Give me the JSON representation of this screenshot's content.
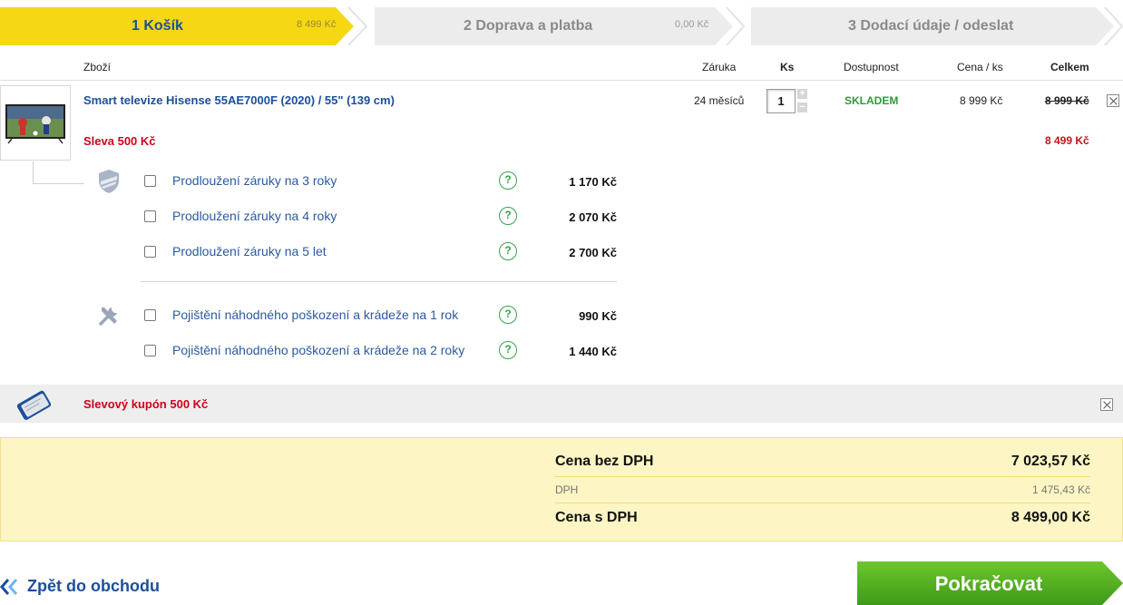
{
  "steps": [
    {
      "title": "1 Košík",
      "amount": "8 499 Kč",
      "active": true
    },
    {
      "title": "2 Doprava a platba",
      "amount": "0,00 Kč",
      "active": false
    },
    {
      "title": "3 Dodací údaje / odeslat",
      "amount": "",
      "active": false
    }
  ],
  "table_header": {
    "item": "Zboží",
    "warranty": "Záruka",
    "qty": "Ks",
    "availability": "Dostupnost",
    "unit_price": "Cena / ks",
    "total": "Celkem"
  },
  "product": {
    "name": "Smart televize Hisense 55AE7000F (2020) / 55\" (139 cm)",
    "warranty": "24 měsíců",
    "quantity": "1",
    "availability": "SKLADEM",
    "unit_price": "8 999 Kč",
    "old_total": "8 999 Kč",
    "discount_label": "Sleva 500 Kč",
    "new_total": "8 499 Kč",
    "image_icon": "tv-thumbnail"
  },
  "services": {
    "warranty_icon": "shield-icon",
    "insurance_icon": "tools-icon",
    "warranty_options": [
      {
        "label": "Prodloužení záruky na 3 roky",
        "price": "1 170 Kč"
      },
      {
        "label": "Prodloužení záruky na 4 roky",
        "price": "2 070 Kč"
      },
      {
        "label": "Prodloužení záruky na 5 let",
        "price": "2 700 Kč"
      }
    ],
    "insurance_options": [
      {
        "label": "Pojištění náhodného poškození a krádeže na 1 rok",
        "price": "990 Kč"
      },
      {
        "label": "Pojištění náhodného poškození a krádeže na 2 roky",
        "price": "1 440 Kč"
      }
    ],
    "help_glyph": "?"
  },
  "coupon": {
    "label": "Slevový kupón 500 Kč",
    "icon": "coupon-card-icon"
  },
  "summary": {
    "net_label": "Cena bez DPH",
    "net_value": "7 023,57 Kč",
    "vat_label": "DPH",
    "vat_value": "1 475,43 Kč",
    "gross_label": "Cena s DPH",
    "gross_value": "8 499,00 Kč"
  },
  "actions": {
    "back_label": "Zpět do obchodu",
    "continue_label": "Pokračovat"
  },
  "colors": {
    "accent_yellow": "#f6d713",
    "link_blue": "#1b4f9c",
    "red": "#d0021b",
    "green": "#2f9a3a",
    "button_green": "#55b520"
  }
}
